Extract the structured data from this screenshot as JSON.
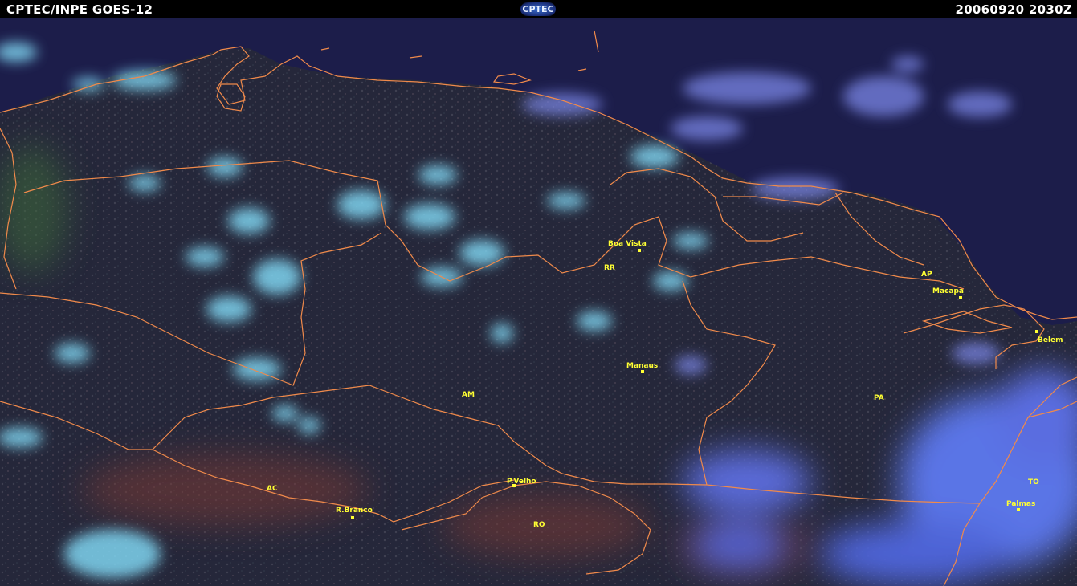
{
  "header": {
    "source": "CPTEC/INPE  GOES-12",
    "logo": "CPTEC",
    "datetime": "20060920  2030Z"
  },
  "colors": {
    "header_bg": "#000000",
    "header_text": "#ffffff",
    "label": "#ffff33",
    "borders": "#f08a4b",
    "ocean": "#1c1d4a",
    "land": "#2a2c38",
    "cloud_cold": "#7fd4f0",
    "cloud_mid": "#7a86e6"
  },
  "map": {
    "states": {
      "rr": "RR",
      "ap": "AP",
      "am": "AM",
      "pa": "PA",
      "ac": "AC",
      "ro": "RO",
      "to": "TO"
    },
    "cities": {
      "boa_vista": "Boa Vista",
      "macapa": "Macapa",
      "belem": "Belem",
      "manaus": "Manaus",
      "p_velho": "P.Velho",
      "r_branco": "R.Branco",
      "palmas": "Palmas"
    }
  }
}
